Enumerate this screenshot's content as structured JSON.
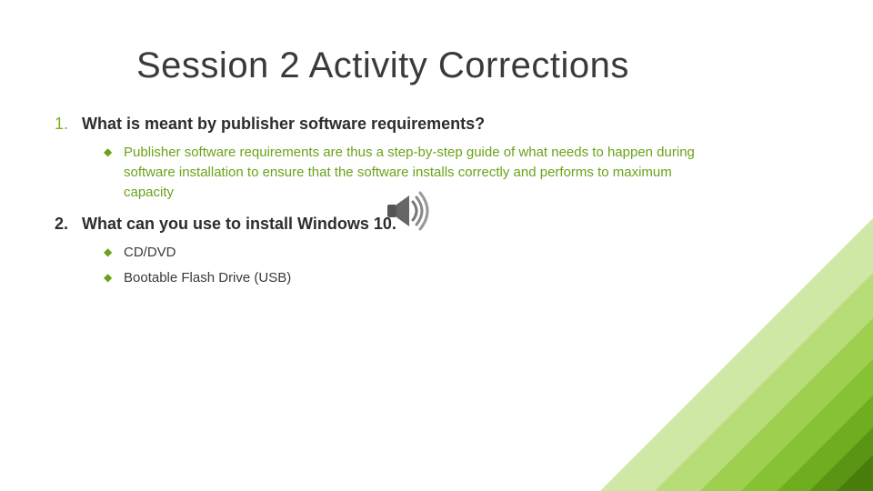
{
  "title": "Session 2 Activity Corrections",
  "q1": {
    "num": "1.",
    "text": "What is meant by publisher software requirements?",
    "answer": "Publisher software requirements are thus a step-by-step guide of what needs to happen during software installation  to ensure that the software installs correctly and performs to maximum capacity"
  },
  "q2": {
    "num": "2.",
    "text": "What can you use to install Windows 10.",
    "answers": [
      "CD/DVD",
      "Bootable Flash Drive (USB)"
    ]
  },
  "bullet_glyph": "◆"
}
